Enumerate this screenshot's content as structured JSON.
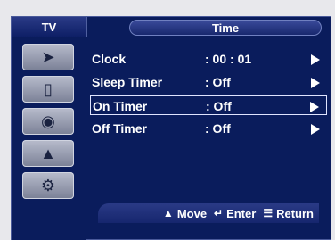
{
  "header": {
    "tab_label": "TV",
    "title": "Time"
  },
  "sidebar": {
    "icons": [
      "antenna-icon",
      "picture-icon",
      "sound-icon",
      "channel-icon",
      "setup-icon"
    ]
  },
  "menu": {
    "rows": [
      {
        "label": "Clock",
        "value": ": 00 : 01"
      },
      {
        "label": "Sleep Timer",
        "value": ": Off"
      },
      {
        "label": "On Timer",
        "value": ": Off"
      },
      {
        "label": "Off Timer",
        "value": ": Off"
      }
    ],
    "selected_index": 2
  },
  "footer": {
    "move_label": "Move",
    "enter_label": "Enter",
    "return_label": "Return"
  }
}
